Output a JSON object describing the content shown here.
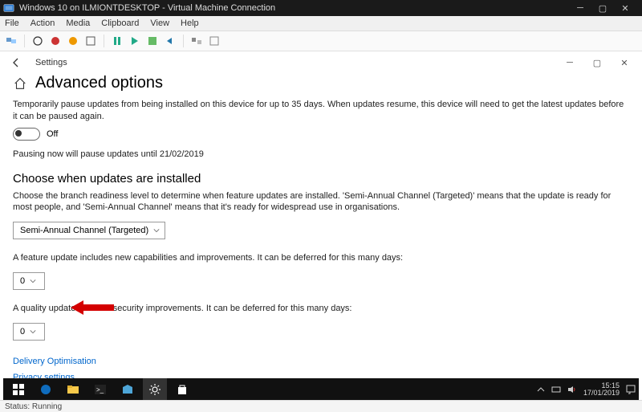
{
  "vm": {
    "title": "Windows 10 on ILMIONTDESKTOP - Virtual Machine Connection",
    "menu": [
      "File",
      "Action",
      "Media",
      "Clipboard",
      "View",
      "Help"
    ]
  },
  "settings": {
    "app_name": "Settings",
    "page_title": "Advanced options",
    "pause_desc": "Temporarily pause updates from being installed on this device for up to 35 days. When updates resume, this device will need to get the latest updates before it can be paused again.",
    "toggle_state": "Off",
    "pause_until": "Pausing now will pause updates until 21/02/2019",
    "choose_heading": "Choose when updates are installed",
    "choose_desc": "Choose the branch readiness level to determine when feature updates are installed. 'Semi-Annual Channel (Targeted)' means that the update is ready for most people, and 'Semi-Annual Channel' means that it's ready for widespread use in organisations.",
    "branch_value": "Semi-Annual Channel (Targeted)",
    "feature_defer_label": "A feature update includes new capabilities and improvements. It can be deferred for this many days:",
    "feature_defer_value": "0",
    "quality_defer_label": "A quality update includes security improvements. It can be deferred for this many days:",
    "quality_defer_value": "0",
    "links": {
      "delivery": "Delivery Optimisation",
      "privacy": "Privacy settings"
    }
  },
  "taskbar": {
    "time": "15:15",
    "date": "17/01/2019"
  },
  "status": "Status: Running"
}
